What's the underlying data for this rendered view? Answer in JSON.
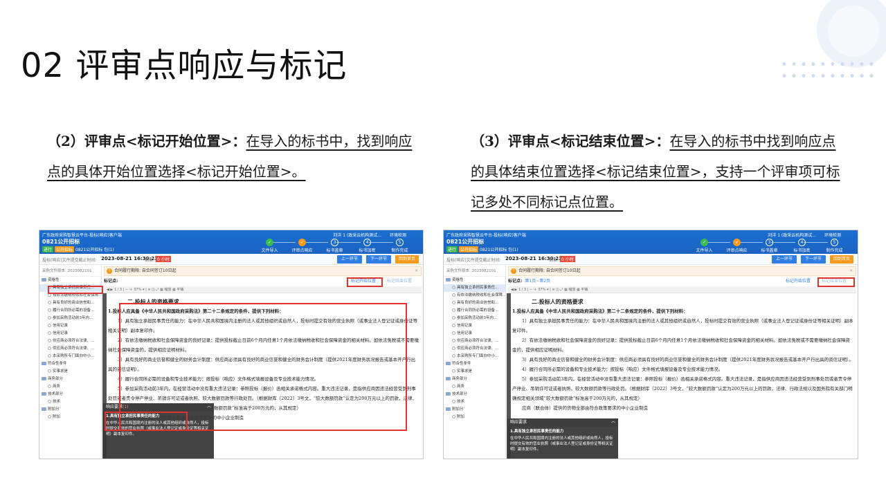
{
  "slide": {
    "title": "02 评审点响应与标记",
    "left": {
      "heading": "（2）评审点<标记开始位置>：",
      "body": "在导入的标书中，找到响应点的具体开始位置选择<标记开始位置>。"
    },
    "right": {
      "heading": "（3）评审点<标记结束位置>：",
      "body": "在导入的标书中找到响应点的具体结束位置选择<标记结束位置>，支持一个评审项可标记多处不同标记点位置。"
    }
  },
  "app": {
    "platform": "广东政府采购智慧云平台-投标(响应)客户端",
    "project": "0821公开招标",
    "badge_doing": "进行",
    "badge_type": "公开招标",
    "project_sub": "0821公开招标   包(1)",
    "user": "刘洋 1 (政采云机构测试...",
    "env": "环境检测",
    "steps": [
      {
        "num": "✓",
        "label": "文件导入",
        "state": "done"
      },
      {
        "num": "✓",
        "label": "评审点响应",
        "state": "cur"
      },
      {
        "num": "3",
        "label": "标书盖章",
        "state": "todo"
      },
      {
        "num": "4",
        "label": "标书加密",
        "state": "todo"
      },
      {
        "num": "5",
        "label": "制作完成",
        "state": "todo"
      }
    ],
    "deadline_label": "投标(响应)文件提交截止时间:",
    "deadline_time": "2023-08-21 16:30:23",
    "remaining_label": "剩余:",
    "remaining": "0 小时",
    "btn_prev": "上一环节",
    "btn_next": "下一环节",
    "btn_back": "回到首页",
    "version": "采购文件版本: 2023082101",
    "warning": "合同履行期限: 自合同签订10日起",
    "mark_label": "标记点:",
    "mark_links": "第1页~第2页",
    "mark_start": "标记开始位置",
    "mark_end": "标记结束位置",
    "toolbar": "◀ ▶  1 / 3  |  −  ＋  37%  ▾  |  ≡  ◫  ⤢  ▦ 缩放  ▦ 平铺",
    "tree": [
      {
        "type": "folder",
        "label": "资格性",
        "sel": false
      },
      {
        "type": "leaf",
        "label": "具有独立承担民事责任...",
        "sel": true
      },
      {
        "type": "leaf",
        "label": "有依法缴纳税收和社会保障...",
        "sel": false
      },
      {
        "type": "leaf",
        "label": "具有良好的商业信誉和...",
        "sel": false
      },
      {
        "type": "leaf",
        "label": "履行合同所必需的设备...",
        "sel": false
      },
      {
        "type": "leaf",
        "label": "参加采购活动前3年内...",
        "sel": false
      },
      {
        "type": "leaf",
        "label": "信用记录",
        "sel": false
      },
      {
        "type": "leaf",
        "label": "信用记录",
        "sel": false
      },
      {
        "type": "leaf",
        "label": "供应商必须符合法律、...",
        "sel": false
      },
      {
        "type": "leaf",
        "label": "供应商必须符合法律、...",
        "sel": false
      },
      {
        "type": "leaf",
        "label": "本采购所专门面向中小...",
        "sel": false
      },
      {
        "type": "folder",
        "label": "符合性条件",
        "sel": false
      },
      {
        "type": "leaf",
        "label": "实事求是",
        "sel": false
      },
      {
        "type": "folder",
        "label": "商务部分",
        "sel": false
      },
      {
        "type": "leaf",
        "label": "商务",
        "sel": false
      },
      {
        "type": "folder",
        "label": "技术部分",
        "sel": false
      },
      {
        "type": "leaf",
        "label": "技术",
        "sel": false
      },
      {
        "type": "folder",
        "label": "附加分",
        "sel": false
      },
      {
        "type": "leaf",
        "label": "附加",
        "sel": false
      }
    ],
    "doc": {
      "heading": "二.投标人的资格要求",
      "intro": "1.投标人应具备《中华人民共和国政府采购法》第二十二条规定的条件，提供下列材料：",
      "p1": "1）具有独立承担民事责任的能力：在中华人民共和国境内注册的法人或其他组织或自然人，投标时提交有效的营业执照（或事业法人登记证或身份证等相关证明）副本复印件。",
      "p2": "2）有依法缴纳税收和社会保障资金的良好记录：提供投标截止日前6个月内任意1个月依法缴纳税收和社会保障资金的相关材料。如依法免税或不需要缴纳社会保障资金的，提供相应证明材料。",
      "p3": "3）具有良好的商业信誉和健全的财务会计制度：供应商必须具有良好的商业信誉和健全的财务会计制度（提供2021年度财务状况报告或基本开户行出具的资信证明）。",
      "p4": "4）履行合同所必需的设备和专业技术能力：按投标（响应）文件格式填报设备及专业技术能力情况。",
      "p5": "5）参加采购活动前3年内，在经营活动中没有重大违法记录：参照投标（报价）函相关承诺格式内容。重大违法记录，是指供应商因违法经营受到刑事处罚或者责令停产停业、吊销许可证或者执照、较大数额罚款等行政处罚。（根据财库〔2022〕3号文，“较大数额罚款”认定为200万元以上的罚款，法律、行政法规以及国务院有关部门明确规定相关领域“较大数额罚款”标准高于200万元的，从其规定）",
      "p6": "应商（联合体）提供的货物全部由符合政策要求的中小企业制造"
    },
    "popup": {
      "header": "响应要求",
      "count": "(1)",
      "title": "1.具有独立承担民事责任的能力",
      "body": "在中华人民共和国境内注册的法人或其他组织或自然人，投标时提交有效的营业执照（或事业法人登记证或身份证等相关证明）副本复印件。"
    }
  }
}
